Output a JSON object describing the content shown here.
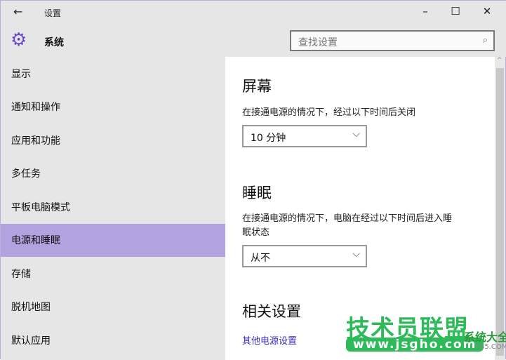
{
  "window": {
    "title": "设置",
    "back_icon": "←",
    "minimize": "–",
    "maximize": "☐",
    "close": "✕"
  },
  "header": {
    "section": "系统",
    "search_placeholder": "查找设置",
    "search_icon": "⌕"
  },
  "sidebar": {
    "items": [
      {
        "label": "显示"
      },
      {
        "label": "通知和操作"
      },
      {
        "label": "应用和功能"
      },
      {
        "label": "多任务"
      },
      {
        "label": "平板电脑模式"
      },
      {
        "label": "电源和睡眠",
        "active": true
      },
      {
        "label": "存储"
      },
      {
        "label": "脱机地图"
      },
      {
        "label": "默认应用"
      }
    ]
  },
  "main": {
    "screen": {
      "title": "屏幕",
      "desc": "在接通电源的情况下，经过以下时间后关闭",
      "value": "10 分钟"
    },
    "sleep": {
      "title": "睡眠",
      "desc": "在接通电源的情况下，电脑在经过以下时间后进入睡眠状态",
      "value": "从不"
    },
    "related": {
      "title": "相关设置",
      "link": "其他电源设置"
    }
  },
  "watermark": {
    "name": "技术员联盟",
    "url": "www.jsgho.com",
    "sub": "系统大全",
    "sub_url": "P85.COM"
  },
  "colors": {
    "accent": "#b3a1e0",
    "gear": "#6a48c8",
    "link": "#3b2cc0"
  }
}
